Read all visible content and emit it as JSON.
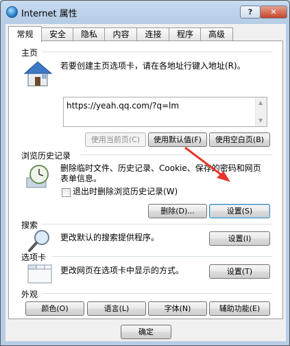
{
  "window": {
    "title": "Internet 属性",
    "help": "?",
    "close": "✕"
  },
  "tabs": [
    "常规",
    "安全",
    "隐私",
    "内容",
    "连接",
    "程序",
    "高级"
  ],
  "home": {
    "title": "主页",
    "desc": "若要创建主页选项卡，请在各地址行键入地址(R)。",
    "url": "https://yeah.qq.com/?q=lm",
    "btn_current": "使用当前页(C)",
    "btn_default": "使用默认值(F)",
    "btn_blank": "使用空白页(B)"
  },
  "history": {
    "title": "浏览历史记录",
    "desc_line1": "删除临时文件、历史记录、Cookie、保存的密码和网页",
    "desc_line2": "表单信息。",
    "checkbox": "退出时删除浏览历史记录(W)",
    "btn_delete": "删除(D)...",
    "btn_settings": "设置(S)"
  },
  "search": {
    "title": "搜索",
    "desc": "更改默认的搜索提供程序。",
    "btn_settings": "设置(I)"
  },
  "tabs_group": {
    "title": "选项卡",
    "desc": "更改网页在选项卡中显示的方式。",
    "btn_settings": "设置(T)"
  },
  "appearance": {
    "title": "外观",
    "btn_colors": "颜色(O)",
    "btn_languages": "语言(L)",
    "btn_fonts": "字体(N)",
    "btn_accessibility": "辅助功能(E)"
  },
  "footer": {
    "btn_ok": "确定"
  },
  "colors": {
    "annotation_arrow": "#e8352a"
  }
}
